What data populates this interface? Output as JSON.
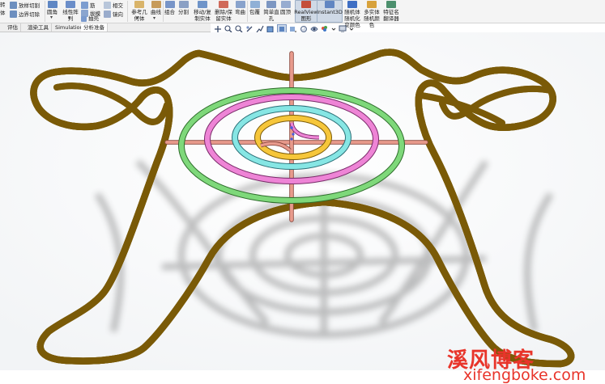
{
  "ribbon": {
    "cut_tools": [
      {
        "icon": "lofted-cut-icon",
        "label": "放样切割",
        "color": "#6d8fbf"
      },
      {
        "icon": "boundary-cut-icon",
        "label": "边界切除",
        "color": "#6d8fbf"
      }
    ],
    "fillet_label": "圆角",
    "linear_pattern_label": "线性阵\n列",
    "rib_label": "筋",
    "draft_label": "拔模",
    "intersect_label": "相交",
    "shell_label": "抽壳",
    "mirror_label": "镜向",
    "ref_geometry_label": "参考几\n何体",
    "curves_label": "曲线",
    "combine_label": "组合",
    "split_label": "分割",
    "move_copy_label": "移动/复\n制实体",
    "delete_keep_label": "删除/保\n留实体",
    "flex_label": "弯曲",
    "wrap_label": "包覆",
    "simple_hole_label": "简单直\n孔",
    "dome_label": "圆顶",
    "realview_label": "RealView\n图形",
    "instant3d_label": "Instant3D",
    "blue_toggle_label": "随机体\n随机化\n变颜色",
    "multi_body_label": "多实体\n随机颜\n色",
    "feature_name_label": "特征名\n翻译器",
    "left_edge_label": "转",
    "left_edge_label2": "体"
  },
  "tabs": [
    {
      "label": "评估"
    },
    {
      "label": "渲染工具"
    },
    {
      "label": "Simulation"
    },
    {
      "label": "分析准备"
    }
  ],
  "hud_icons": [
    "zoom-to-fit-icon",
    "zoom-area-icon",
    "previous-view-icon",
    "section-view-icon",
    "dynamic-annotation-icon",
    "view-orientation-icon",
    "display-style-icon",
    "hide-show-icon",
    "edit-appearance-icon",
    "apply-scene-icon",
    "view-settings-icon",
    "monitor-icon"
  ],
  "colors": {
    "frame_yellow": "#f6c63a",
    "ring_green": "#7ed87a",
    "ring_pink": "#ee84d6",
    "ring_cyan": "#86e6e4",
    "cross_pink": "#e89a8c",
    "watermark": "#e8342a"
  },
  "watermark": {
    "title": "溪风博客",
    "url": "xifengboke.com"
  }
}
